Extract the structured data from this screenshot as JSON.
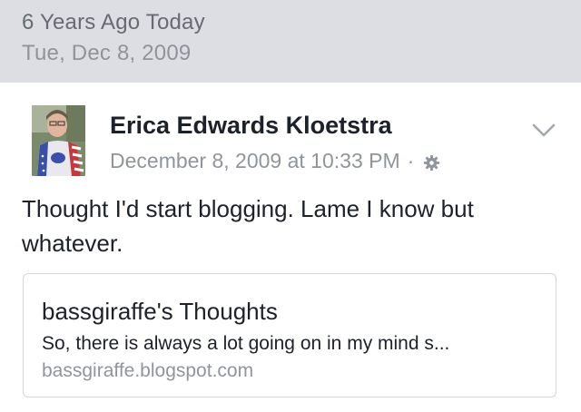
{
  "memory": {
    "title": "6 Years Ago Today",
    "date": "Tue, Dec 8, 2009"
  },
  "post": {
    "author": "Erica Edwards Kloetstra",
    "timestamp": "December 8, 2009 at 10:33 PM",
    "separator": "·",
    "privacy_icon": "gear-icon",
    "menu_icon": "chevron-down-icon",
    "text": "Thought I'd start blogging. Lame I know but whatever.",
    "link": {
      "title": "bassgiraffe's Thoughts",
      "description": "So, there is always a lot going on in my mind s...",
      "domain": "bassgiraffe.blogspot.com"
    }
  },
  "colors": {
    "header_bg": "#dcdee3",
    "text_primary": "#1d2129",
    "text_secondary": "#90949c"
  }
}
